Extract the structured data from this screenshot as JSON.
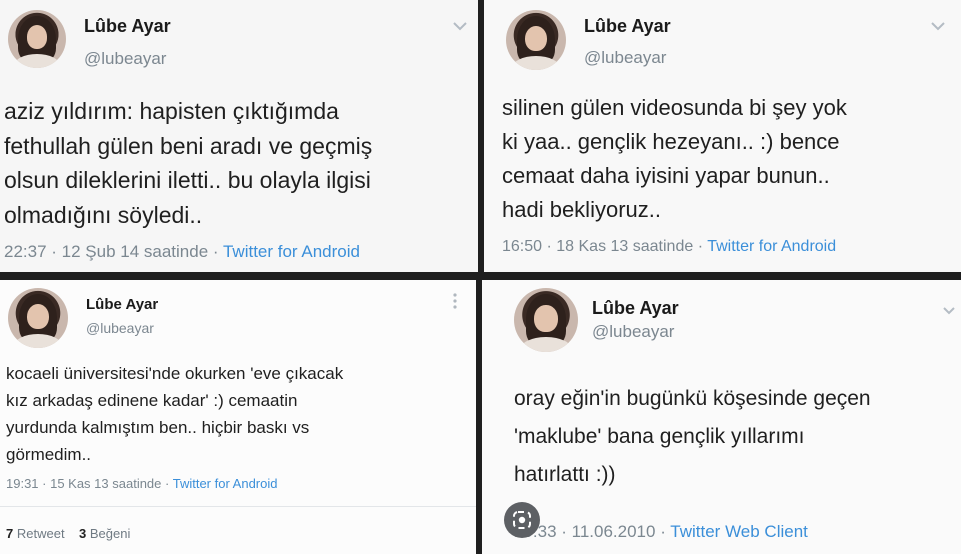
{
  "tweets": [
    {
      "name": "Lûbe Ayar",
      "handle": "@lubeayar",
      "lines": [
        "aziz yıldırım: hapisten çıktığımda",
        "fethullah gülen beni aradı ve geçmiş",
        "olsun dileklerini iletti.. bu olayla ilgisi",
        "olmadığını söyledi.."
      ],
      "time": "22:37 · 12 Şub 14 saatinde · ",
      "source": "Twitter for Android"
    },
    {
      "name": "Lûbe Ayar",
      "handle": "@lubeayar",
      "lines": [
        "silinen gülen videosunda bi şey yok",
        "ki yaa.. gençlik hezeyanı.. :) bence",
        "cemaat daha iyisini yapar bunun..",
        "hadi bekliyoruz.."
      ],
      "time": "16:50 · 18 Kas 13 saatinde · ",
      "source": "Twitter for Android"
    },
    {
      "name": "Lûbe Ayar",
      "handle": "@lubeayar",
      "lines": [
        "kocaeli üniversitesi'nde okurken 'eve çıkacak",
        "kız arkadaş edinene kadar' :) cemaatin",
        "yurdunda kalmıştım ben.. hiçbir baskı vs",
        "görmedim.."
      ],
      "time": "19:31 · 15 Kas 13 saatinde · ",
      "source": "Twitter for Android",
      "retweet_count": "7",
      "retweet_label": "Retweet",
      "like_count": "3",
      "like_label": "Beğeni"
    },
    {
      "name": "Lûbe Ayar",
      "handle": "@lubeayar",
      "lines": [
        "oray eğin'in bugünkü köşesinde geçen",
        "'maklube' bana gençlik yıllarımı",
        "hatırlattı :))"
      ],
      "time": "19:33 · 11.06.2010 · ",
      "source": "Twitter Web Client"
    }
  ],
  "icons": {
    "chevron": "chevron-down-icon",
    "more": "more-vertical-icon",
    "lens": "lens-search-icon"
  },
  "colors": {
    "link": "#3b8fd9",
    "meta": "#7b8790",
    "divider_background": "#1f1f1f"
  }
}
